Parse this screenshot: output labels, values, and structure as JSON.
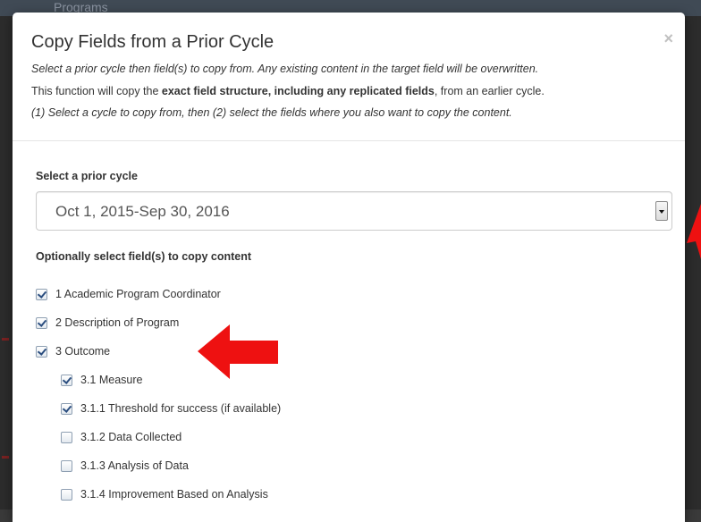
{
  "background": {
    "title": "Programs"
  },
  "modal": {
    "title": "Copy Fields from a Prior Cycle",
    "close_label": "×",
    "instructions": {
      "line1": "Select a prior cycle then field(s) to copy from. Any existing content in the target field will be overwritten.",
      "line2_pre": "This function will copy the ",
      "line2_bold": "exact field structure, including any replicated fields",
      "line2_post": ", from an earlier cycle.",
      "line3": "(1) Select a cycle to copy from, then (2) select the fields where you also want to copy the content."
    },
    "cycle_label": "Select a prior cycle",
    "cycle_selected": "Oct 1, 2015-Sep 30, 2016",
    "fields_label": "Optionally select field(s) to copy content",
    "fields": [
      {
        "label": "1 Academic Program Coordinator",
        "checked": true,
        "level": 0
      },
      {
        "label": "2 Description of Program",
        "checked": true,
        "level": 0
      },
      {
        "label": "3 Outcome",
        "checked": true,
        "level": 0
      },
      {
        "label": "3.1 Measure",
        "checked": true,
        "level": 1
      },
      {
        "label": "3.1.1 Threshold for success (if available)",
        "checked": true,
        "level": 1
      },
      {
        "label": "3.1.2 Data Collected",
        "checked": false,
        "level": 1
      },
      {
        "label": "3.1.3 Analysis of Data",
        "checked": false,
        "level": 1
      },
      {
        "label": "3.1.4 Improvement Based on Analysis",
        "checked": false,
        "level": 1
      }
    ]
  },
  "colors": {
    "annotation_arrow": "#ee1111",
    "checkbox_check": "#2a4d7f",
    "text": "#333333"
  }
}
